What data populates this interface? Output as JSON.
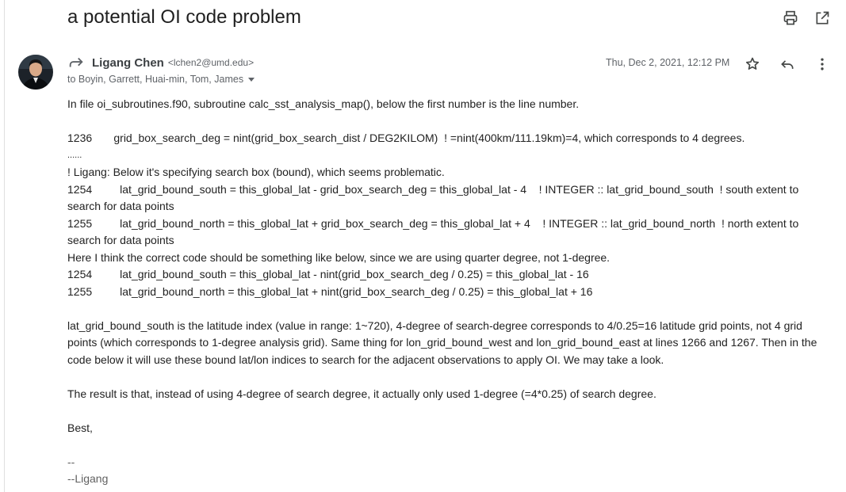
{
  "subject": "a potential OI code problem",
  "toolbar": {
    "print_icon": "print-icon",
    "open_new_window_icon": "open-in-new-icon"
  },
  "sender": {
    "name": "Ligang Chen",
    "email": "<lchen2@umd.edu>",
    "recipients": "to Boyin, Garrett, Huai-min, Tom, James",
    "date": "Thu, Dec 2, 2021, 12:12 PM"
  },
  "body": {
    "intro": "In file oi_subroutines.f90, subroutine calc_sst_analysis_map(), below the first number is the line number.",
    "line_1236": "1236       grid_box_search_deg = nint(grid_box_search_dist / DEG2KILOM)  ! =nint(400km/111.19km)=4, which corresponds to 4 degrees.",
    "ellipsis": "......",
    "comment": "! Ligang: Below it's specifying search box (bound), which seems problematic.",
    "line_1254_old": "1254         lat_grid_bound_south = this_global_lat - grid_box_search_deg = this_global_lat - 4    ! INTEGER :: lat_grid_bound_south  ! south extent to search for data points",
    "line_1255_old": "1255         lat_grid_bound_north = this_global_lat + grid_box_search_deg = this_global_lat + 4    ! INTEGER :: lat_grid_bound_north  ! north extent to search for data points",
    "suggestion": "Here I think the correct code should be something like below, since we are using quarter degree, not 1-degree.",
    "line_1254_new": "1254         lat_grid_bound_south = this_global_lat - nint(grid_box_search_deg / 0.25) = this_global_lat - 16",
    "line_1255_new": "1255         lat_grid_bound_north = this_global_lat + nint(grid_box_search_deg / 0.25) = this_global_lat + 16",
    "explanation": "lat_grid_bound_south is the latitude index (value in range: 1~720), 4-degree of search-degree corresponds to 4/0.25=16 latitude grid points, not 4 grid points (which corresponds to 1-degree analysis grid). Same thing for lon_grid_bound_west and lon_grid_bound_east at lines 1266 and 1267. Then in the code below it will use these bound lat/lon indices to search for the adjacent observations to apply OI. We may take a look.",
    "result": "The result is that, instead of using 4-degree of search degree, it actually only used 1-degree (=4*0.25) of search degree.",
    "closing": "Best,",
    "sig_dash": "--",
    "sig_name": "--Ligang"
  }
}
